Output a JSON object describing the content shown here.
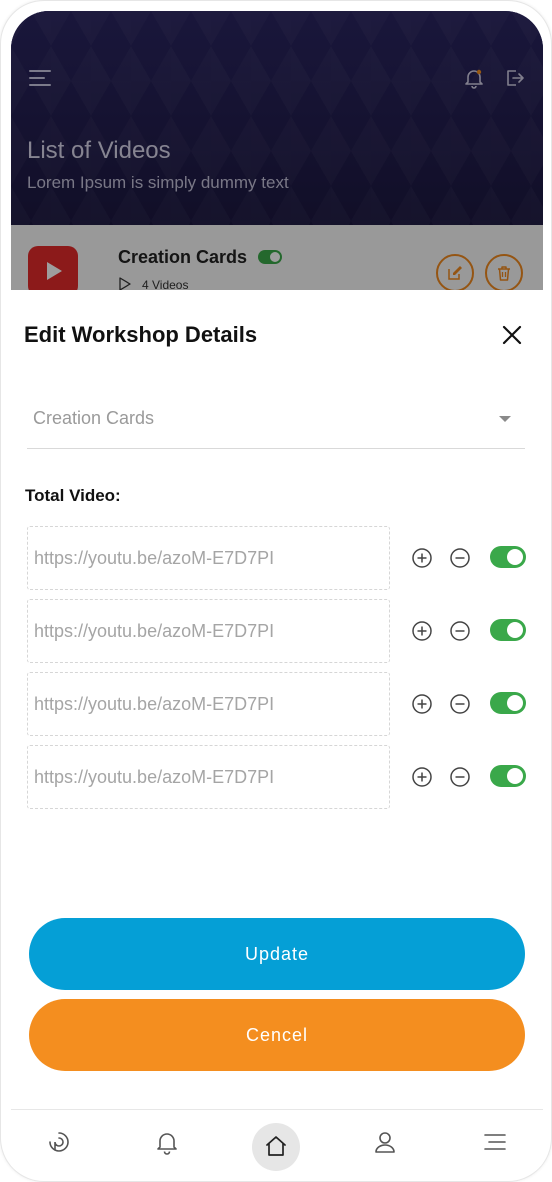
{
  "header": {
    "title": "List of Videos",
    "subtitle": "Lorem Ipsum is simply dummy text",
    "icons": [
      "menu-icon",
      "bell-icon",
      "logout-icon"
    ]
  },
  "card": {
    "title": "Creation Cards",
    "count": "4 Videos",
    "enabled": true
  },
  "modal": {
    "title": "Edit Workshop Details",
    "select_value": "Creation Cards",
    "total_label": "Total Video:",
    "videos": [
      {
        "url": "https://youtu.be/azoM-E7D7PI",
        "enabled": true
      },
      {
        "url": "https://youtu.be/azoM-E7D7PI",
        "enabled": true
      },
      {
        "url": "https://youtu.be/azoM-E7D7PI",
        "enabled": true
      },
      {
        "url": "https://youtu.be/azoM-E7D7PI",
        "enabled": true
      }
    ],
    "update_label": "Update",
    "cancel_label": "Cencel"
  },
  "colors": {
    "header_bg": "#1f1b48",
    "accent_blue": "#059fd6",
    "accent_orange": "#f48e1f",
    "toggle_green": "#3aa84a"
  },
  "bottom_nav": {
    "items": [
      "feed-icon",
      "bell-icon",
      "home-icon",
      "user-icon",
      "menu-icon"
    ],
    "active": "home-icon"
  }
}
